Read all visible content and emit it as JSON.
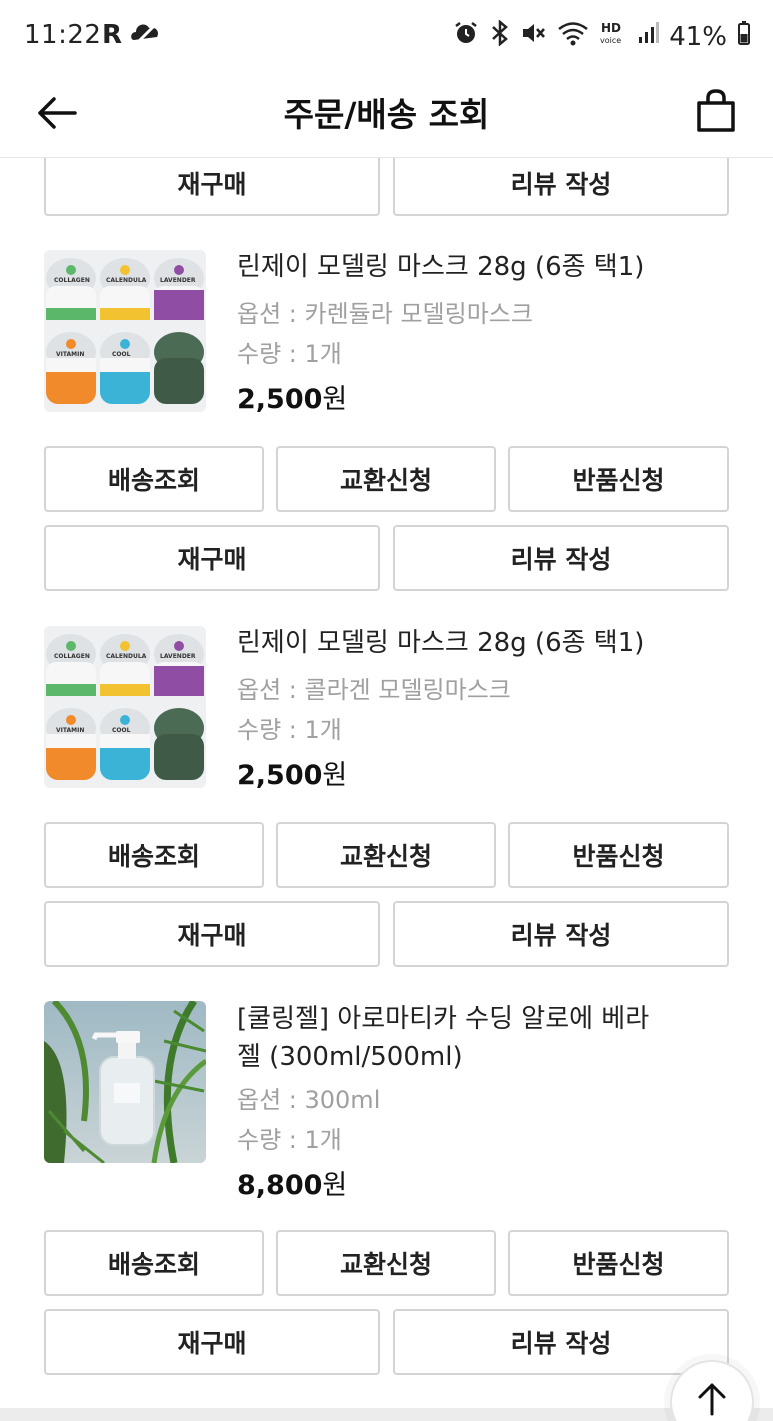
{
  "status_bar": {
    "time": "11:22",
    "carrier_icon_label": "R",
    "battery": "41%",
    "icons": [
      "alarm-icon",
      "bluetooth-icon",
      "mute-icon",
      "wifi-icon",
      "hd-voice-icon",
      "signal-icon",
      "battery-icon"
    ]
  },
  "header": {
    "title": "주문/배송 조회",
    "back_icon": "back-arrow-icon",
    "bag_icon": "shopping-bag-icon"
  },
  "buttons": {
    "track": "배송조회",
    "exchange": "교환신청",
    "return": "반품신청",
    "rebuy": "재구매",
    "review": "리뷰 작성"
  },
  "items": [
    {
      "name": "린제이 모델링 마스크 28g (6종 택1)",
      "option": "옵션 : 카렌듈라 모델링마스크",
      "quantity": "수량 : 1개",
      "price": "2,500",
      "currency": "원",
      "thumb_labels": [
        "COLLAGEN",
        "CALENDULA",
        "LAVENDER",
        "VITAMIN",
        "COOL",
        ""
      ]
    },
    {
      "name": "린제이 모델링 마스크 28g (6종 택1)",
      "option": "옵션 : 콜라겐 모델링마스크",
      "quantity": "수량 : 1개",
      "price": "2,500",
      "currency": "원",
      "thumb_labels": [
        "COLLAGEN",
        "CALENDULA",
        "LAVENDER",
        "VITAMIN",
        "COOL",
        ""
      ]
    },
    {
      "name": "[쿨링젤] 아로마티카 수딩 알로에 베라 젤 (300ml/500ml)",
      "option": "옵션 : 300ml",
      "quantity": "수량 : 1개",
      "price": "8,800",
      "currency": "원"
    }
  ],
  "colors": {
    "border": "#d4d4d4",
    "muted_text": "#a0a0a0",
    "title_text": "#111111",
    "mask_colors": [
      "#5bb86a",
      "#f2c230",
      "#8f4ea3",
      "#f08a2a",
      "#3bb3d6",
      "#3f5a47"
    ]
  }
}
